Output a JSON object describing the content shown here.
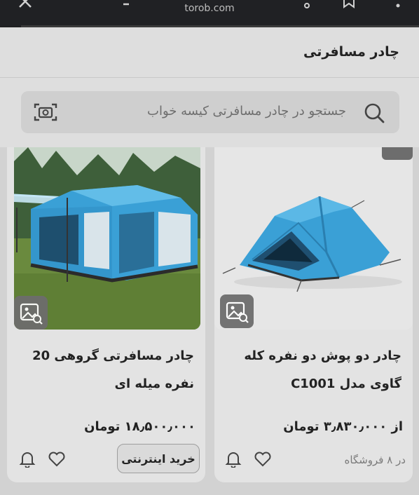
{
  "browser": {
    "url": "torob.com"
  },
  "header": {
    "title": "چادر مسافرتی"
  },
  "search": {
    "placeholder": "جستجو در چادر مسافرتی کیسه خواب"
  },
  "products": [
    {
      "title": "چادر دو پوش دو نفره کله گاوی مدل C1001",
      "price": "از ۳٫۸۳۰٫۰۰۰ تومان",
      "meta": "در ۸ فروشگاه",
      "image_description_icon": "tent-dome-blue"
    },
    {
      "title": "چادر مسافرتی گروهی 20 نفره میله ای",
      "price": "۱۸٫۵۰۰٫۰۰۰ تومان",
      "buy_label": "خرید اینترنتی",
      "image_description_icon": "tent-cabin-blue"
    }
  ],
  "icons": {
    "search": "search-icon",
    "camera": "camera-search-icon",
    "bell": "bell-icon",
    "heart": "heart-icon",
    "image_badge": "image-gallery-icon"
  },
  "colors": {
    "header_bg": "#dedede",
    "search_bg": "#cfcfcf",
    "card_bg": "#e3e3e3",
    "tent_blue": "#3aa0d6"
  }
}
